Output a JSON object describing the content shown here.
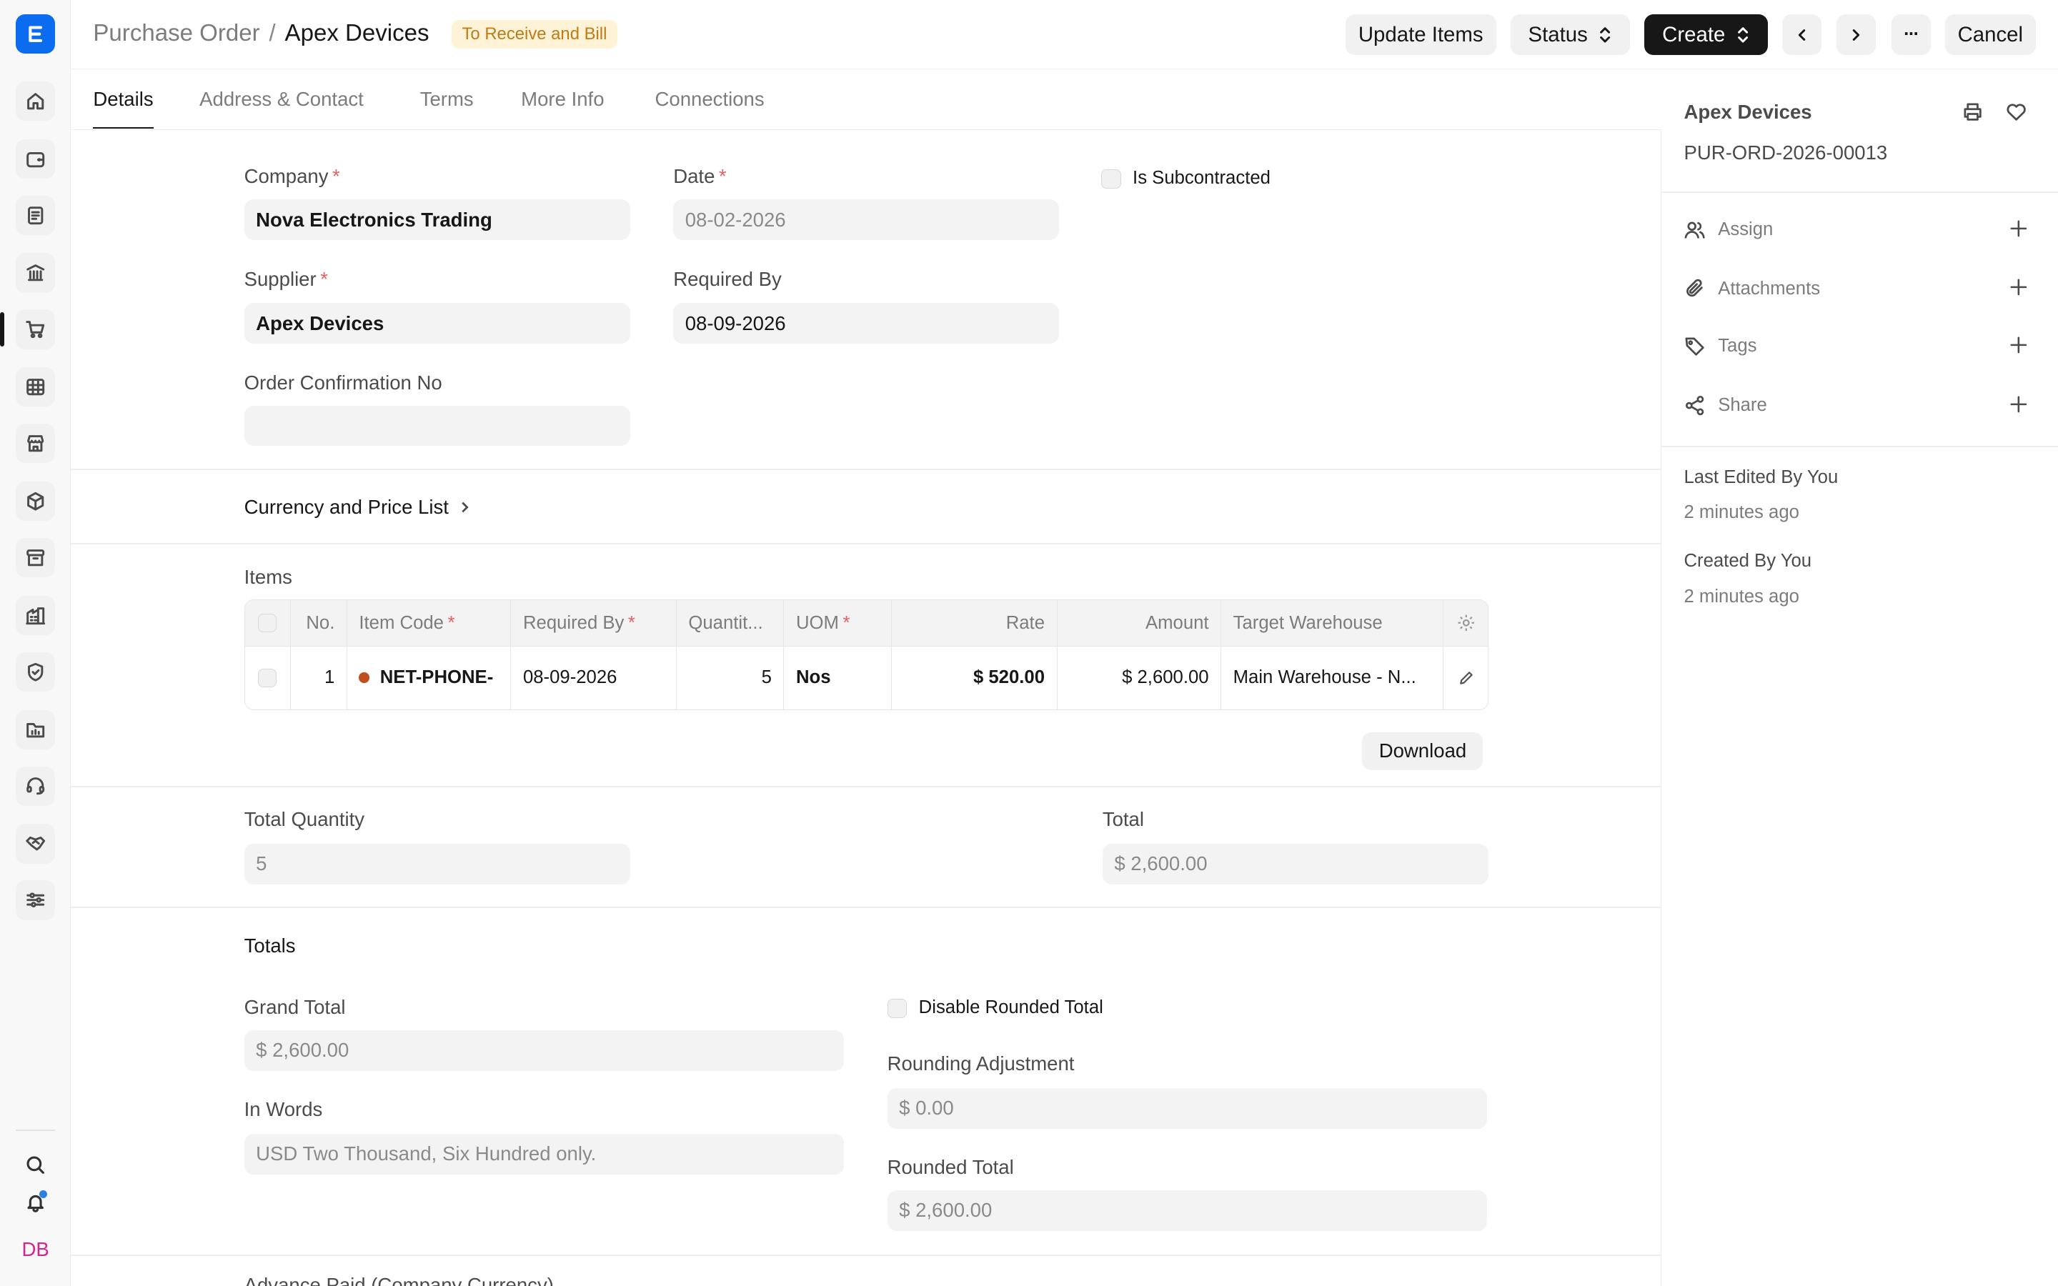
{
  "rail": {
    "avatar_initials": "DB",
    "icons": [
      "home-icon",
      "wallet-icon",
      "document-icon",
      "bank-icon",
      "cart-icon",
      "table-icon",
      "store-icon",
      "box-icon",
      "archive-icon",
      "building-icon",
      "shield-icon",
      "folder-chart-icon",
      "headset-icon",
      "handshake-icon",
      "sliders-icon"
    ]
  },
  "header": {
    "breadcrumb_parent": "Purchase Order",
    "breadcrumb_separator": "/",
    "title": "Apex Devices",
    "status": "To Receive and Bill",
    "buttons": {
      "update_items": "Update Items",
      "status": "Status",
      "create": "Create",
      "more": "···",
      "cancel": "Cancel"
    }
  },
  "tabs": [
    "Details",
    "Address & Contact",
    "Terms",
    "More Info",
    "Connections"
  ],
  "form": {
    "company_label": "Company",
    "company_value": "Nova Electronics Trading",
    "date_label": "Date",
    "date_value": "08-02-2026",
    "is_subcontracted_label": "Is Subcontracted",
    "supplier_label": "Supplier",
    "supplier_value": "Apex Devices",
    "required_by_label": "Required By",
    "required_by_value": "08-09-2026",
    "order_confirmation_label": "Order Confirmation No",
    "order_confirmation_value": "",
    "required_mark": "*"
  },
  "currency_section": {
    "title": "Currency and Price List"
  },
  "items": {
    "label": "Items",
    "columns": {
      "no": "No.",
      "item_code": "Item Code",
      "required_by": "Required By",
      "quantity": "Quantit...",
      "uom": "UOM",
      "rate": "Rate",
      "amount": "Amount",
      "target_warehouse": "Target Warehouse"
    },
    "rows": [
      {
        "no": "1",
        "item_code": "NET-PHONE-",
        "required_by": "08-09-2026",
        "quantity": "5",
        "uom": "Nos",
        "rate": "$ 520.00",
        "amount": "$ 2,600.00",
        "target_warehouse": "Main Warehouse - N..."
      }
    ],
    "download_label": "Download"
  },
  "summary": {
    "total_quantity_label": "Total Quantity",
    "total_quantity_value": "5",
    "total_label": "Total",
    "total_value": "$ 2,600.00"
  },
  "totals": {
    "title": "Totals",
    "grand_total_label": "Grand Total",
    "grand_total_value": "$ 2,600.00",
    "disable_rounded_total_label": "Disable Rounded Total",
    "rounding_adjustment_label": "Rounding Adjustment",
    "rounding_adjustment_value": "$ 0.00",
    "in_words_label": "In Words",
    "in_words_value": "USD Two Thousand, Six Hundred only.",
    "rounded_total_label": "Rounded Total",
    "rounded_total_value": "$ 2,600.00",
    "next_section_partial": "Advance Paid (Company Currency)"
  },
  "sidebar": {
    "title": "Apex Devices",
    "doc_id": "PUR-ORD-2026-00013",
    "actions": {
      "assign": "Assign",
      "attachments": "Attachments",
      "tags": "Tags",
      "share": "Share"
    },
    "last_edited": "Last Edited By You",
    "last_edited_time": "2 minutes ago",
    "created": "Created By You",
    "created_time": "2 minutes ago"
  }
}
